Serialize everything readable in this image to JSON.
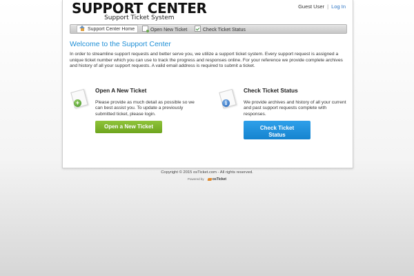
{
  "header": {
    "logo_line1": "SUPPORT CENTER",
    "logo_line2": "Support Ticket System",
    "user_label": "Guest User",
    "separator": "|",
    "login_link": "Log In"
  },
  "nav": {
    "items": [
      {
        "label": "Support Center Home",
        "icon": "home-icon",
        "active": true
      },
      {
        "label": "Open New Ticket",
        "icon": "new-ticket-icon",
        "active": false
      },
      {
        "label": "Check Ticket Status",
        "icon": "check-status-icon",
        "active": false
      }
    ]
  },
  "main": {
    "welcome_title": "Welcome to the Support Center",
    "intro": "In order to streamline support requests and better serve you, we utilize a support ticket system. Every support request is assigned a unique ticket number which you can use to track the progress and responses online. For your reference we provide complete archives and history of all your support requests. A valid email address is required to submit a ticket."
  },
  "panels": {
    "open": {
      "title": "Open A New Ticket",
      "text": "Please provide as much detail as possible so we can best assist you. To update a previously submitted ticket, please login.",
      "button": "Open a New Ticket",
      "icon": "add-ticket-icon"
    },
    "check": {
      "title": "Check Ticket Status",
      "text": "We provide archives and history of all your current and past support requests complete with responses.",
      "button_line1": "Check Ticket",
      "button_line2": "Status",
      "icon": "info-ticket-icon"
    }
  },
  "footer": {
    "copyright": "Copyright © 2015 osTicket.com - All rights reserved.",
    "powered_by": "Powered by",
    "powered_logo": "osTicket"
  },
  "colors": {
    "accent": "#1f8fd6",
    "link": "#2a73c3",
    "green_button": "#7cb32a",
    "blue_button": "#1d90dd"
  }
}
